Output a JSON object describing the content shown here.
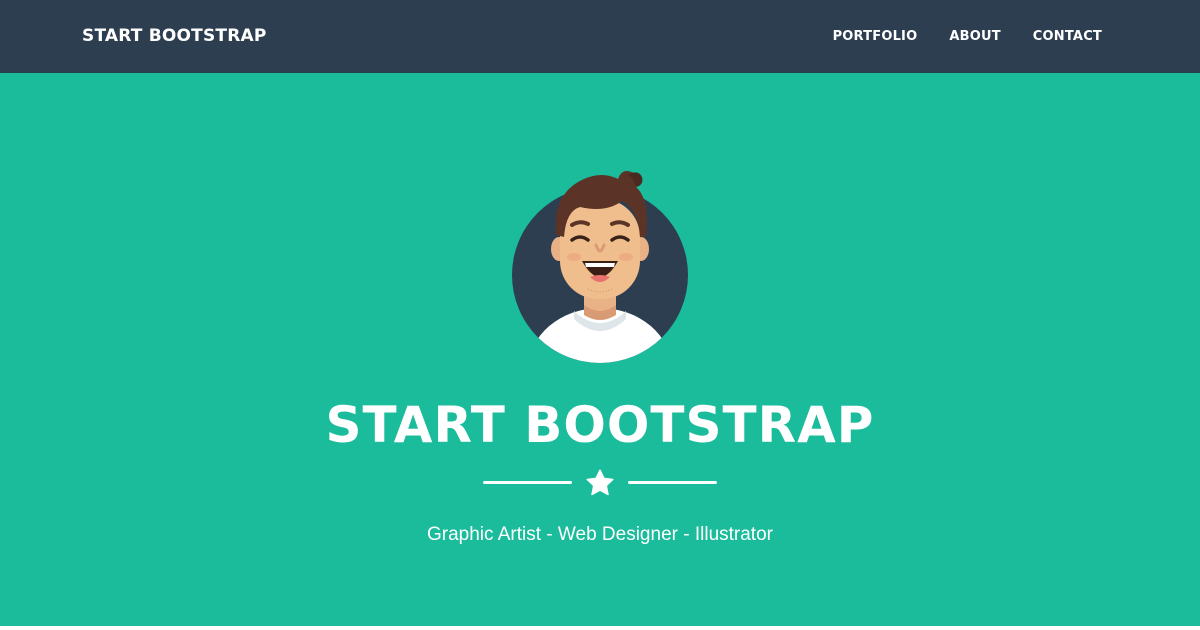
{
  "navbar": {
    "brand": "START BOOTSTRAP",
    "links": [
      {
        "label": "PORTFOLIO"
      },
      {
        "label": "ABOUT"
      },
      {
        "label": "CONTACT"
      }
    ]
  },
  "hero": {
    "title": "START BOOTSTRAP",
    "subtitle": "Graphic Artist - Web Designer - Illustrator",
    "avatar_icon": "avatar-illustration-icon",
    "divider_icon": "star-icon"
  },
  "colors": {
    "navbar_bg": "#2c3e50",
    "hero_bg": "#1abc9c",
    "text": "#ffffff",
    "avatar_circle": "#2c3e50"
  }
}
